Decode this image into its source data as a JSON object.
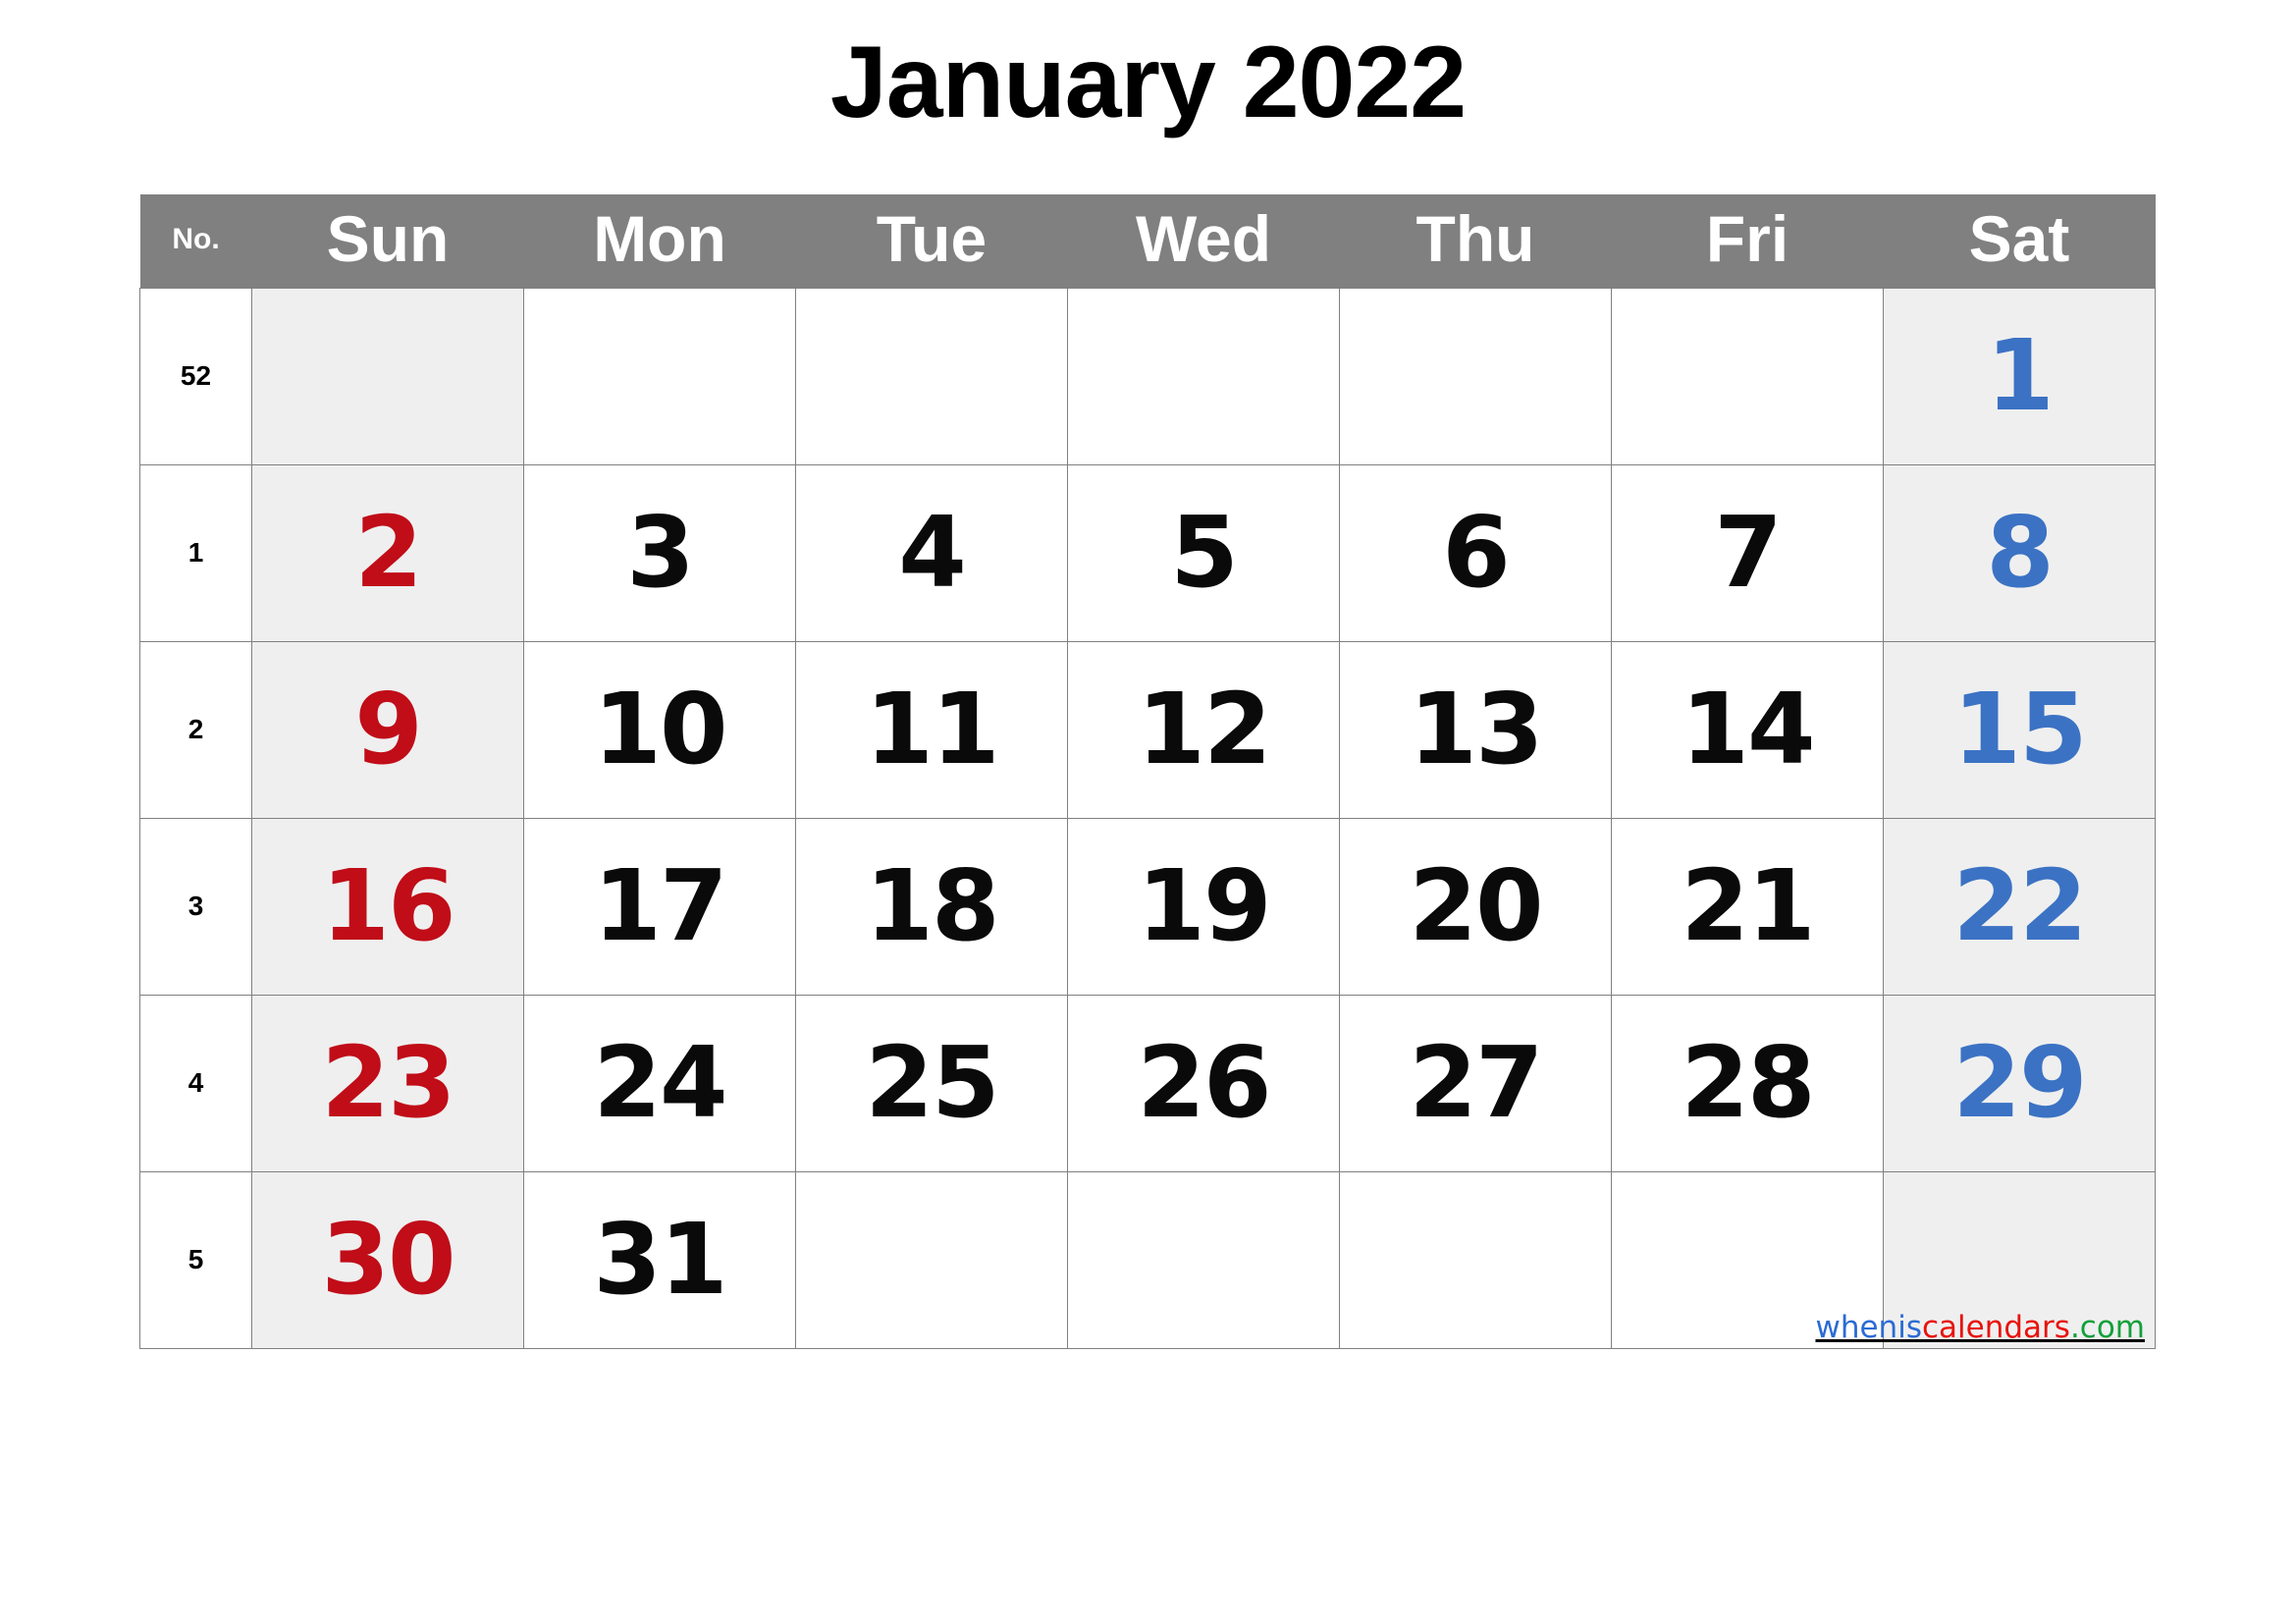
{
  "title": "January 2022",
  "month": "January",
  "year": "2022",
  "colors": {
    "header_background": "#808080",
    "header_text": "#ffffff",
    "weekend_cell_background": "#efefef",
    "sunday_text": "#c00d18",
    "saturday_text": "#3b72c4",
    "weekday_text": "#0a0a0a",
    "grid_border": "#808080",
    "page_background": "#ffffff"
  },
  "header": {
    "week_number_label": "No.",
    "days": [
      "Sun",
      "Mon",
      "Tue",
      "Wed",
      "Thu",
      "Fri",
      "Sat"
    ]
  },
  "weeks": [
    {
      "number": "52",
      "days": [
        {
          "n": "",
          "kind": "sun"
        },
        {
          "n": "",
          "kind": "wd"
        },
        {
          "n": "",
          "kind": "wd"
        },
        {
          "n": "",
          "kind": "wd"
        },
        {
          "n": "",
          "kind": "wd"
        },
        {
          "n": "",
          "kind": "wd"
        },
        {
          "n": "1",
          "kind": "sat"
        }
      ]
    },
    {
      "number": "1",
      "days": [
        {
          "n": "2",
          "kind": "sun"
        },
        {
          "n": "3",
          "kind": "wd"
        },
        {
          "n": "4",
          "kind": "wd"
        },
        {
          "n": "5",
          "kind": "wd"
        },
        {
          "n": "6",
          "kind": "wd"
        },
        {
          "n": "7",
          "kind": "wd"
        },
        {
          "n": "8",
          "kind": "sat"
        }
      ]
    },
    {
      "number": "2",
      "days": [
        {
          "n": "9",
          "kind": "sun"
        },
        {
          "n": "10",
          "kind": "wd"
        },
        {
          "n": "11",
          "kind": "wd"
        },
        {
          "n": "12",
          "kind": "wd"
        },
        {
          "n": "13",
          "kind": "wd"
        },
        {
          "n": "14",
          "kind": "wd"
        },
        {
          "n": "15",
          "kind": "sat"
        }
      ]
    },
    {
      "number": "3",
      "days": [
        {
          "n": "16",
          "kind": "sun"
        },
        {
          "n": "17",
          "kind": "wd"
        },
        {
          "n": "18",
          "kind": "wd"
        },
        {
          "n": "19",
          "kind": "wd"
        },
        {
          "n": "20",
          "kind": "wd"
        },
        {
          "n": "21",
          "kind": "wd"
        },
        {
          "n": "22",
          "kind": "sat"
        }
      ]
    },
    {
      "number": "4",
      "days": [
        {
          "n": "23",
          "kind": "sun"
        },
        {
          "n": "24",
          "kind": "wd"
        },
        {
          "n": "25",
          "kind": "wd"
        },
        {
          "n": "26",
          "kind": "wd"
        },
        {
          "n": "27",
          "kind": "wd"
        },
        {
          "n": "28",
          "kind": "wd"
        },
        {
          "n": "29",
          "kind": "sat"
        }
      ]
    },
    {
      "number": "5",
      "days": [
        {
          "n": "30",
          "kind": "sun"
        },
        {
          "n": "31",
          "kind": "wd"
        },
        {
          "n": "",
          "kind": "wd"
        },
        {
          "n": "",
          "kind": "wd"
        },
        {
          "n": "",
          "kind": "wd"
        },
        {
          "n": "",
          "kind": "wd"
        },
        {
          "n": "",
          "kind": "sat"
        }
      ]
    }
  ],
  "watermark": {
    "part1": "whenis",
    "part2": "calendars",
    "part3": ".com",
    "full": "wheniscalendars.com"
  }
}
